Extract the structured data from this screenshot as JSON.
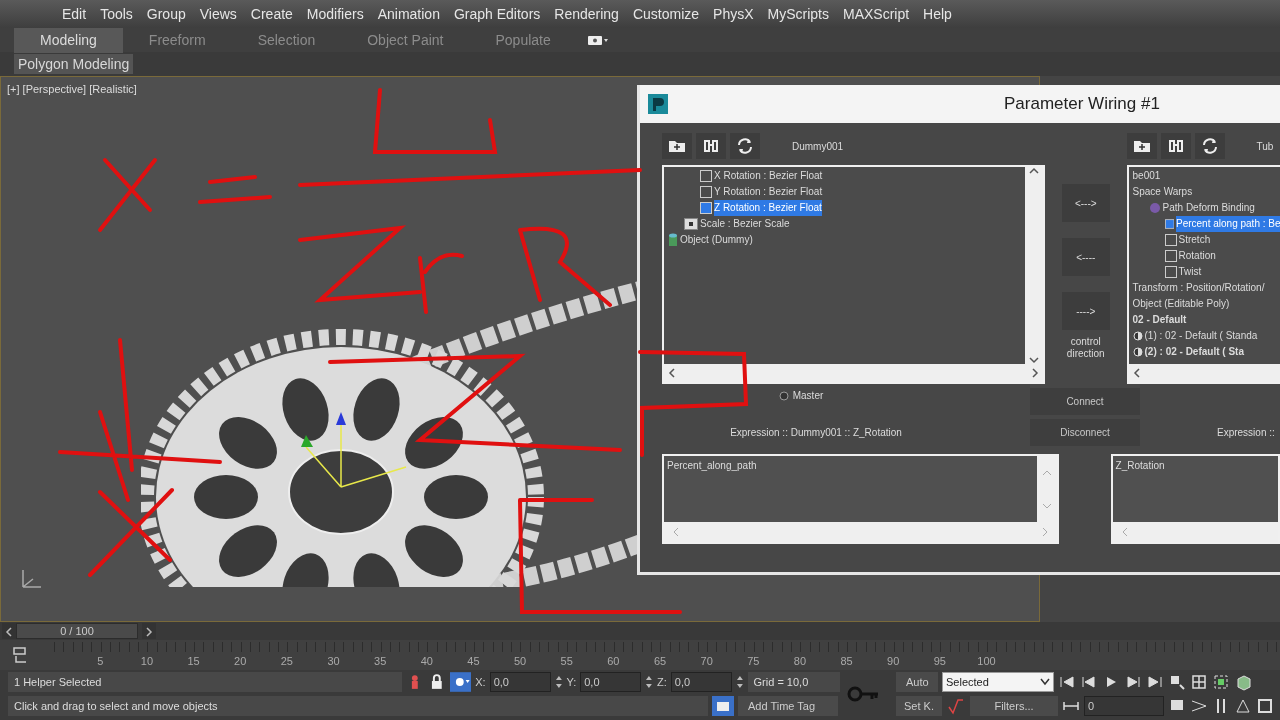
{
  "menu": [
    "Edit",
    "Tools",
    "Group",
    "Views",
    "Create",
    "Modifiers",
    "Animation",
    "Graph Editors",
    "Rendering",
    "Customize",
    "PhysX",
    "MyScripts",
    "MAXScript",
    "Help"
  ],
  "ribbon_tabs": [
    {
      "label": "Modeling",
      "selected": true
    },
    {
      "label": "Freeform",
      "selected": false
    },
    {
      "label": "Selection",
      "selected": false
    },
    {
      "label": "Object Paint",
      "selected": false
    },
    {
      "label": "Populate",
      "selected": false
    }
  ],
  "ribbon_panel": "Polygon Modeling",
  "viewport": {
    "label": "[+] [Perspective] [Realistic]"
  },
  "dialog": {
    "title": "Parameter Wiring #1",
    "left": {
      "object": "Dummy001",
      "tree": [
        {
          "children": [
            {
              "children": [
                {
                  "label": "X Rotation : Bezier Float",
                  "kind": "controller",
                  "selected": false
                },
                {
                  "label": "Y Rotation : Bezier Float",
                  "kind": "controller",
                  "selected": false
                },
                {
                  "label": "Z Rotation : Bezier Float",
                  "kind": "controller",
                  "selected": true
                }
              ]
            },
            {
              "label": "Scale : Bezier Scale",
              "kind": "scale",
              "selected": false
            }
          ]
        },
        {
          "label": "Object (Dummy)",
          "kind": "object",
          "selected": false
        }
      ],
      "expression_label": "Expression :: Dummy001 :: Z_Rotation",
      "expression": "Percent_along_path"
    },
    "direction_buttons": [
      "<--->",
      "<----",
      "---->"
    ],
    "direction_caption": "control direction",
    "master": {
      "label": "Master",
      "selected": false
    },
    "actions": [
      "Connect",
      "Disconnect"
    ],
    "right": {
      "object": "Tub",
      "tree": [
        {
          "label": "be001",
          "kind": "plain",
          "selected": false
        },
        {
          "label": "Space Warps",
          "kind": "plain",
          "selected": false,
          "children": [
            {
              "label": "Path Deform Binding",
              "kind": "binding",
              "selected": false,
              "children": [
                {
                  "label": "Percent along path : Be",
                  "kind": "controller",
                  "selected": true
                },
                {
                  "label": "Stretch",
                  "kind": "controller",
                  "selected": false
                },
                {
                  "label": "Rotation",
                  "kind": "controller",
                  "selected": false
                },
                {
                  "label": "Twist",
                  "kind": "controller",
                  "selected": false
                }
              ]
            }
          ]
        },
        {
          "label": "Transform : Position/Rotation/",
          "kind": "plain",
          "selected": false
        },
        {
          "label": "Object (Editable Poly)",
          "kind": "plain",
          "selected": false
        },
        {
          "label": "02 - Default",
          "kind": "plain",
          "selected": false,
          "bold": true
        },
        {
          "label": "(1) : 02 - Default  ( Standa",
          "kind": "material",
          "selected": false
        },
        {
          "label": "(2) : 02 - Default  ( Sta",
          "kind": "material",
          "selected": false,
          "bold": true
        }
      ],
      "expression_label": "Expression ::",
      "expression": "Z_Rotation"
    }
  },
  "time_slider": {
    "reading": "0 / 100",
    "level": 0
  },
  "ruler_ticks": [
    "5",
    "10",
    "15",
    "20",
    "25",
    "30",
    "35",
    "40",
    "45",
    "50",
    "55",
    "60",
    "65",
    "70",
    "75",
    "80",
    "85",
    "90",
    "95",
    "100"
  ],
  "status": {
    "selection": "1 Helper Selected",
    "prompt": "Click and drag to select and move objects",
    "x": {
      "label": "X:",
      "value": "0,0"
    },
    "y": {
      "label": "Y:",
      "value": "0,0"
    },
    "z": {
      "label": "Z:",
      "value": "0,0"
    },
    "grid": "Grid = 10,0",
    "time_tag": "Add Time Tag",
    "auto_key": "Auto",
    "set_key": "Set K.",
    "key_filter": "Selected",
    "filters": "Filters...",
    "frame": "0"
  }
}
